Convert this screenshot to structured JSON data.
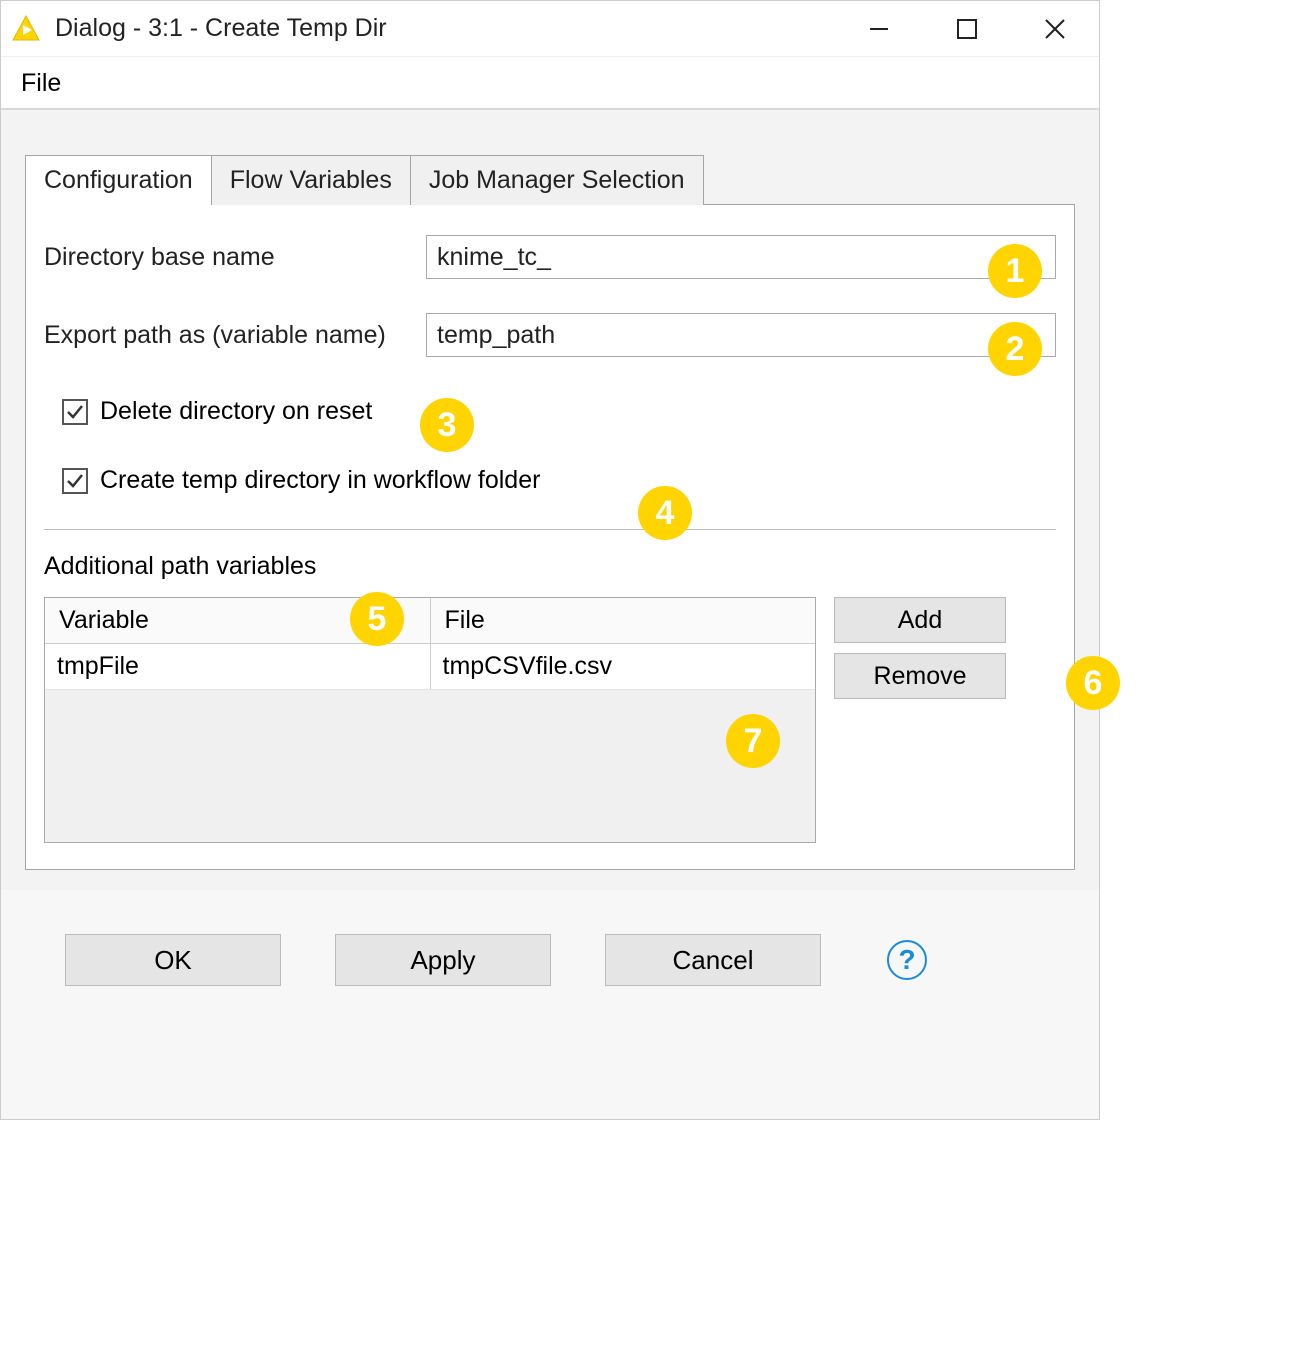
{
  "window": {
    "title": "Dialog - 3:1 - Create Temp Dir"
  },
  "menubar": {
    "file": "File"
  },
  "tabs": {
    "configuration": "Configuration",
    "flow_variables": "Flow Variables",
    "job_manager": "Job Manager Selection"
  },
  "form": {
    "dir_base_label": "Directory base name",
    "dir_base_value": "knime_tc_",
    "export_path_label": "Export path as (variable name)",
    "export_path_value": "temp_path",
    "delete_on_reset_label": "Delete directory on reset",
    "create_in_workflow_label": "Create temp directory in workflow folder",
    "additional_vars_label": "Additional path variables"
  },
  "table": {
    "header_variable": "Variable",
    "header_file": "File",
    "rows": [
      {
        "variable": "tmpFile",
        "file": "tmpCSVfile.csv"
      }
    ]
  },
  "side_buttons": {
    "add": "Add",
    "remove": "Remove"
  },
  "footer_buttons": {
    "ok": "OK",
    "apply": "Apply",
    "cancel": "Cancel"
  },
  "annotations": {
    "b1": "1",
    "b2": "2",
    "b3": "3",
    "b4": "4",
    "b5": "5",
    "b6": "6",
    "b7": "7"
  }
}
